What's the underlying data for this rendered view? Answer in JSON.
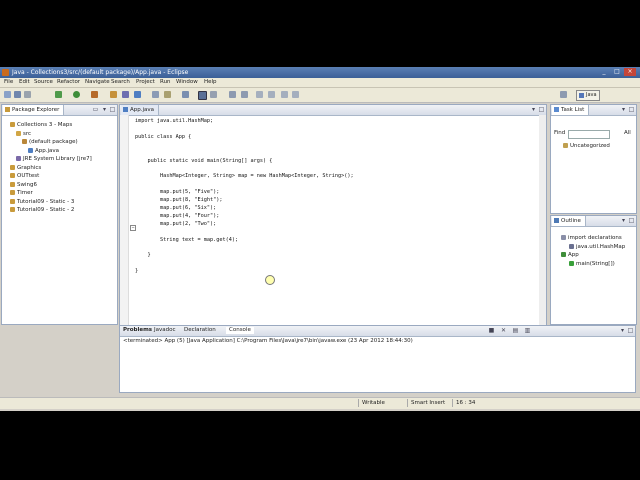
{
  "window": {
    "title": "Java - Collections3/src/(default package)/App.java - Eclipse",
    "minimize_symbol": "_",
    "maximize_symbol": "□",
    "close_symbol": "×"
  },
  "menu": [
    "File",
    "Edit",
    "Source",
    "Refactor",
    "Navigate",
    "Search",
    "Project",
    "Run",
    "Window",
    "Help"
  ],
  "toolbar": {
    "perspective_label": "Java"
  },
  "package_explorer": {
    "tab_label": "Package Explorer",
    "tree": [
      {
        "label": "Collections 3 - Maps",
        "icon": "project-icon",
        "indent": 0
      },
      {
        "label": "src",
        "icon": "source-folder-icon",
        "indent": 1
      },
      {
        "label": "(default package)",
        "icon": "package-icon",
        "indent": 2
      },
      {
        "label": "App.java",
        "icon": "java-file-icon",
        "indent": 3
      },
      {
        "label": "JRE System Library [jre7]",
        "icon": "library-icon",
        "indent": 1
      },
      {
        "label": "Graphics",
        "icon": "project-icon",
        "indent": 0
      },
      {
        "label": "OUTtest",
        "icon": "project-icon",
        "indent": 0
      },
      {
        "label": "Swing6",
        "icon": "project-icon",
        "indent": 0
      },
      {
        "label": "Timer",
        "icon": "project-icon",
        "indent": 0
      },
      {
        "label": "Tutorial09 - Static - 3",
        "icon": "project-icon",
        "indent": 0
      },
      {
        "label": "Tutorial09 - Static - 2",
        "icon": "project-icon",
        "indent": 0
      }
    ]
  },
  "editor": {
    "tab_label": "App.java",
    "lines": [
      "import java.util.HashMap;",
      "",
      "public class App {",
      "",
      "",
      "    public static void main(String[] args) {",
      "",
      "        HashMap<Integer, String> map = new HashMap<Integer, String>();",
      "",
      "        map.put(5, \"Five\");",
      "        map.put(8, \"Eight\");",
      "        map.put(6, \"Six\");",
      "        map.put(4, \"Four\");",
      "        map.put(2, \"Two\");",
      "",
      "        String text = map.get(4);",
      "",
      "    }",
      "",
      "}"
    ]
  },
  "task_list": {
    "tab_label": "Task List",
    "find_label": "Find",
    "all_label": "All",
    "category": "Uncategorized"
  },
  "outline": {
    "tab_label": "Outline",
    "items": [
      {
        "label": "import declarations",
        "icon": "imports-icon",
        "indent": 0
      },
      {
        "label": "java.util.HashMap",
        "icon": "import-icon",
        "indent": 1
      },
      {
        "label": "App",
        "icon": "class-icon",
        "indent": 0
      },
      {
        "label": "main(String[])",
        "icon": "method-icon",
        "indent": 1
      }
    ]
  },
  "bottom_panel": {
    "tabs": [
      "Problems",
      "Javadoc",
      "Declaration",
      "Console"
    ],
    "active_tab": "Console",
    "console_text": "<terminated> App (5) [Java Application] C:\\Program Files\\Java\\jre7\\bin\\javaw.exe (23 Apr 2012 18:44:30)"
  },
  "status_bar": {
    "writable": "Writable",
    "insert_mode": "Smart Insert",
    "position": "16 : 34"
  },
  "colors": {
    "title_bar": "#3b5f97",
    "chrome": "#ece9d8",
    "keyword": "#7f0055",
    "string_literal": "#2a00ff"
  }
}
